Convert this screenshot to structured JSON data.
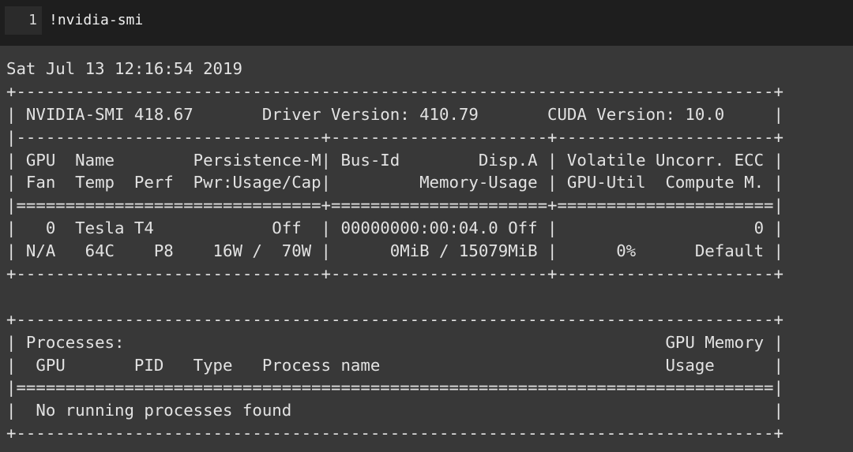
{
  "input_cell": {
    "line_number": "1",
    "code": "!nvidia-smi"
  },
  "output": {
    "lines": [
      "Sat Jul 13 12:16:54 2019",
      "+-----------------------------------------------------------------------------+",
      "| NVIDIA-SMI 418.67       Driver Version: 410.79       CUDA Version: 10.0     |",
      "|-------------------------------+----------------------+----------------------+",
      "| GPU  Name        Persistence-M| Bus-Id        Disp.A | Volatile Uncorr. ECC |",
      "| Fan  Temp  Perf  Pwr:Usage/Cap|         Memory-Usage | GPU-Util  Compute M. |",
      "|===============================+======================+======================|",
      "|   0  Tesla T4            Off  | 00000000:00:04.0 Off |                    0 |",
      "| N/A   64C    P8    16W /  70W |      0MiB / 15079MiB |      0%      Default |",
      "+-------------------------------+----------------------+----------------------+",
      "",
      "+-----------------------------------------------------------------------------+",
      "| Processes:                                                       GPU Memory |",
      "|  GPU       PID   Type   Process name                             Usage      |",
      "|=============================================================================|",
      "|  No running processes found                                                 |",
      "+-----------------------------------------------------------------------------+"
    ]
  }
}
